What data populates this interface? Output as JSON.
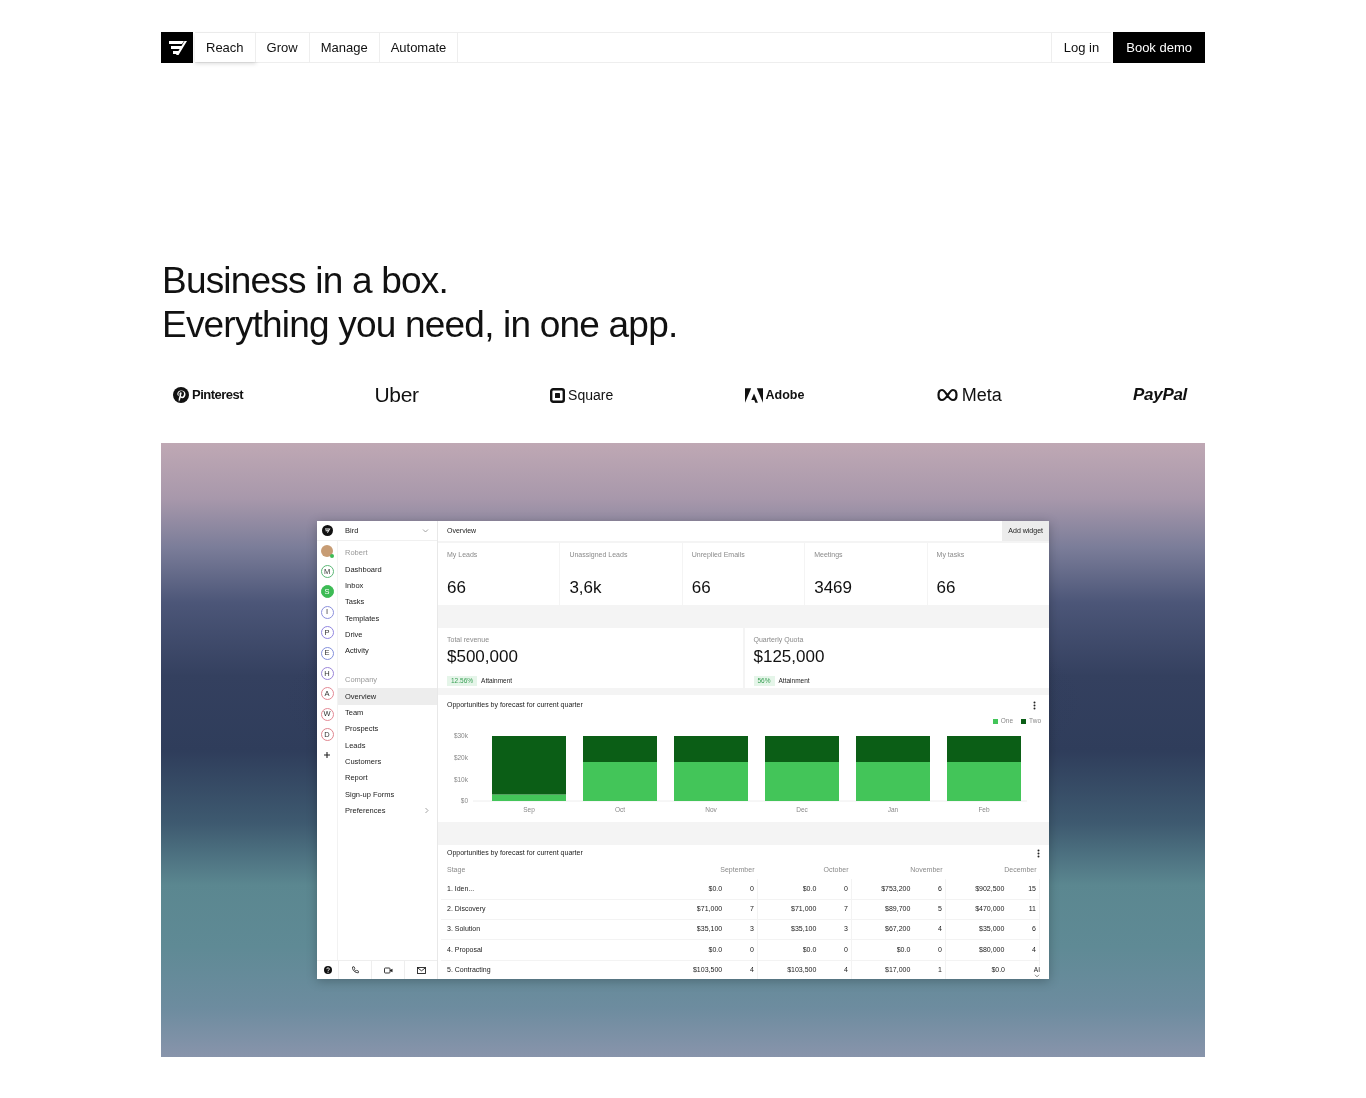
{
  "navbar": {
    "items": [
      {
        "label": "Reach",
        "selected": true
      },
      {
        "label": "Grow",
        "selected": false
      },
      {
        "label": "Manage",
        "selected": false
      },
      {
        "label": "Automate",
        "selected": false
      }
    ],
    "login": "Log in",
    "cta": "Book demo"
  },
  "headline": {
    "lines": [
      "Business in a box.",
      "Everything you need, in one app."
    ]
  },
  "logos": [
    {
      "name": "Pinterest",
      "kind": "pcircle"
    },
    {
      "name": "Uber",
      "kind": "plain"
    },
    {
      "name": "Square",
      "kind": "boxed"
    },
    {
      "name": "Adobe",
      "kind": "amark"
    },
    {
      "name": "Meta",
      "kind": "loop"
    },
    {
      "name": "PayPal",
      "kind": "italic"
    }
  ],
  "app": {
    "workspace": {
      "name": "Bird"
    },
    "rail": [
      {
        "kind": "avatar",
        "online": true
      },
      {
        "kind": "letter",
        "letter": "M",
        "color": "#5cb877",
        "selected": false
      },
      {
        "kind": "letter",
        "letter": "S",
        "color": "#3dbb55",
        "selected": true
      },
      {
        "kind": "letter",
        "letter": "I",
        "color": "#8b8fdc",
        "selected": false
      },
      {
        "kind": "letter",
        "letter": "P",
        "color": "#9186e0",
        "selected": false
      },
      {
        "kind": "letter",
        "letter": "E",
        "color": "#8490dc",
        "selected": false
      },
      {
        "kind": "letter",
        "letter": "H",
        "color": "#9b86d9",
        "selected": false
      },
      {
        "kind": "letter",
        "letter": "A",
        "color": "#e48995",
        "selected": false
      },
      {
        "kind": "letter",
        "letter": "W",
        "color": "#e48995",
        "selected": false
      },
      {
        "kind": "letter",
        "letter": "D",
        "color": "#e0868f",
        "selected": false
      },
      {
        "kind": "add"
      }
    ],
    "menu": [
      {
        "heading": "Robert",
        "items": [
          {
            "label": "Dashboard",
            "selected": false,
            "submenu": false
          },
          {
            "label": "Inbox",
            "selected": false,
            "submenu": false
          },
          {
            "label": "Tasks",
            "selected": false,
            "submenu": false
          },
          {
            "label": "Templates",
            "selected": false,
            "submenu": false
          },
          {
            "label": "Drive",
            "selected": false,
            "submenu": false
          },
          {
            "label": "Activity",
            "selected": false,
            "submenu": false
          }
        ]
      },
      {
        "heading": "Company",
        "items": [
          {
            "label": "Overview",
            "selected": true,
            "submenu": false
          },
          {
            "label": "Team",
            "selected": false,
            "submenu": false
          },
          {
            "label": "Prospects",
            "selected": false,
            "submenu": false
          },
          {
            "label": "Leads",
            "selected": false,
            "submenu": false
          },
          {
            "label": "Customers",
            "selected": false,
            "submenu": false
          },
          {
            "label": "Report",
            "selected": false,
            "submenu": false
          },
          {
            "label": "Sign-up Forms",
            "selected": false,
            "submenu": false
          },
          {
            "label": "Preferences",
            "selected": false,
            "submenu": true
          }
        ]
      }
    ],
    "header": {
      "title": "Overview",
      "button": "Add widget"
    },
    "stats": [
      {
        "label": "My Leads",
        "value": "66"
      },
      {
        "label": "Unassigned Leads",
        "value": "3,6k"
      },
      {
        "label": "Unreplied Emails",
        "value": "66"
      },
      {
        "label": "Meetings",
        "value": "3469"
      },
      {
        "label": "My tasks",
        "value": "66"
      }
    ],
    "revenue": [
      {
        "label": "Total revenue",
        "value": "$500,000",
        "change": "12.56%",
        "note": "Attainment"
      },
      {
        "label": "Quarterly Quota",
        "value": "$125,000",
        "change": "56%",
        "note": "Attainment"
      }
    ],
    "chart": {
      "title": "Opportunities by forecast for current quarter",
      "chart_data": {
        "type": "bar",
        "stacked": true,
        "categories": [
          "Sep",
          "Oct",
          "Nov",
          "Dec",
          "Jan",
          "Feb"
        ],
        "series": [
          {
            "name": "One",
            "color": "#43c559",
            "values": [
              3000,
              18000,
              18000,
              18000,
              18000,
              18000
            ]
          },
          {
            "name": "Two",
            "color": "#0b5e16",
            "values": [
              27000,
              12000,
              12000,
              12000,
              12000,
              12000
            ]
          }
        ],
        "ylim": [
          0,
          30000
        ],
        "yticks": [
          {
            "value": 0,
            "label": "$0"
          },
          {
            "value": 10000,
            "label": "$10k"
          },
          {
            "value": 20000,
            "label": "$20k"
          },
          {
            "value": 30000,
            "label": "$30k"
          }
        ]
      }
    },
    "table": {
      "title": "Opportunities by forecast for current quarter",
      "columns": [
        "Stage",
        "September",
        "October",
        "November",
        "December"
      ],
      "rows": [
        {
          "stage": "1. Iden...",
          "months": [
            {
              "amount": "$0.0",
              "count": "0"
            },
            {
              "amount": "$0.0",
              "count": "0"
            },
            {
              "amount": "$753,200",
              "count": "6"
            },
            {
              "amount": "$902,500",
              "count": "15"
            }
          ]
        },
        {
          "stage": "2. Discovery",
          "months": [
            {
              "amount": "$71,000",
              "count": "7"
            },
            {
              "amount": "$71,000",
              "count": "7"
            },
            {
              "amount": "$89,700",
              "count": "5"
            },
            {
              "amount": "$470,000",
              "count": "11"
            }
          ]
        },
        {
          "stage": "3. Solution",
          "months": [
            {
              "amount": "$35,100",
              "count": "3"
            },
            {
              "amount": "$35,100",
              "count": "3"
            },
            {
              "amount": "$67,200",
              "count": "4"
            },
            {
              "amount": "$35,000",
              "count": "6"
            }
          ]
        },
        {
          "stage": "4. Proposal",
          "months": [
            {
              "amount": "$0.0",
              "count": "0"
            },
            {
              "amount": "$0.0",
              "count": "0"
            },
            {
              "amount": "$0.0",
              "count": "0"
            },
            {
              "amount": "$80,000",
              "count": "4"
            }
          ]
        },
        {
          "stage": "5. Contracting",
          "months": [
            {
              "amount": "$103,500",
              "count": "4"
            },
            {
              "amount": "$103,500",
              "count": "4"
            },
            {
              "amount": "$17,000",
              "count": "1"
            },
            {
              "amount": "$0.0"
            }
          ]
        }
      ]
    },
    "ai_toggle": {
      "label": "AI"
    }
  }
}
